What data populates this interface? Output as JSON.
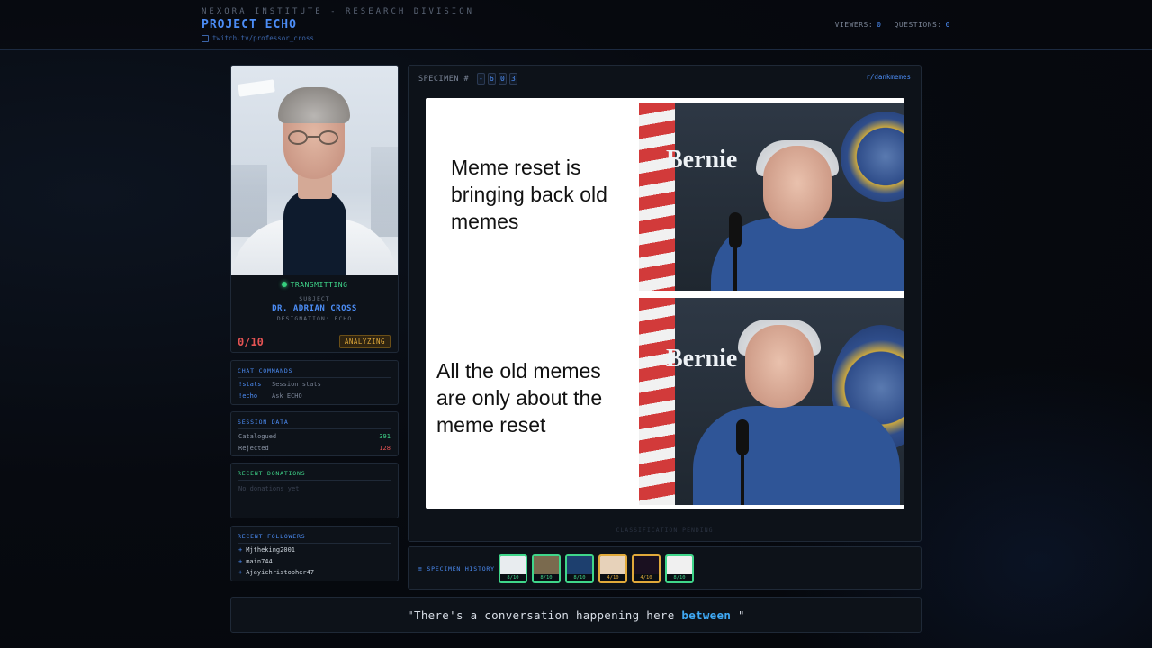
{
  "header": {
    "org": "NEXORA INSTITUTE - RESEARCH DIVISION",
    "project": "PROJECT ECHO",
    "channel": "twitch.tv/professor_cross",
    "viewers_label": "VIEWERS:",
    "viewers": "0",
    "questions_label": "QUESTIONS:",
    "questions": "0"
  },
  "subject": {
    "status": "TRANSMITTING",
    "label": "SUBJECT",
    "name": "DR. ADRIAN CROSS",
    "designation": "DESIGNATION: ECHO",
    "score": "0/10",
    "state": "ANALYZING"
  },
  "commands": {
    "title": "CHAT COMMANDS",
    "items": [
      {
        "key": "!stats",
        "desc": "Session stats"
      },
      {
        "key": "!echo",
        "desc": "Ask ECHO"
      }
    ]
  },
  "session": {
    "title": "SESSION DATA",
    "catalogued_label": "Catalogued",
    "catalogued": "391",
    "rejected_label": "Rejected",
    "rejected": "128"
  },
  "donations": {
    "title": "RECENT DONATIONS",
    "empty": "No donations yet"
  },
  "followers": {
    "title": "RECENT FOLLOWERS",
    "items": [
      "Mjtheking2001",
      "main744",
      "Ajayichristopher47"
    ]
  },
  "specimen": {
    "label": "SPECIMEN #",
    "digits": [
      "-",
      "6",
      "0",
      "3"
    ],
    "subreddit": "r/dankmemes",
    "meme_top": "Meme reset is bringing back old memes",
    "meme_bottom": "All the old memes are only about the meme reset",
    "logo_text": "Bernie",
    "classification": "CLASSIFICATION PENDING"
  },
  "history": {
    "label": "≡ SPECIMEN HISTORY",
    "items": [
      {
        "score": "8/10",
        "status": "green",
        "color": "#e8ecef"
      },
      {
        "score": "8/10",
        "status": "green",
        "color": "#7a6a4e"
      },
      {
        "score": "8/10",
        "status": "green",
        "color": "#1d3f6e"
      },
      {
        "score": "4/10",
        "status": "amber",
        "color": "#e7d2ba"
      },
      {
        "score": "4/10",
        "status": "amber",
        "color": "#1a1020"
      },
      {
        "score": "8/10",
        "status": "green",
        "color": "#f0f0f0"
      }
    ]
  },
  "quote": {
    "text_pre": "\"There's a conversation happening here ",
    "highlight": "between",
    "text_post": " \""
  },
  "colors": {
    "accent": "#4c8df6",
    "green": "#3fd68a",
    "red": "#e45353",
    "amber": "#e0a93a"
  }
}
